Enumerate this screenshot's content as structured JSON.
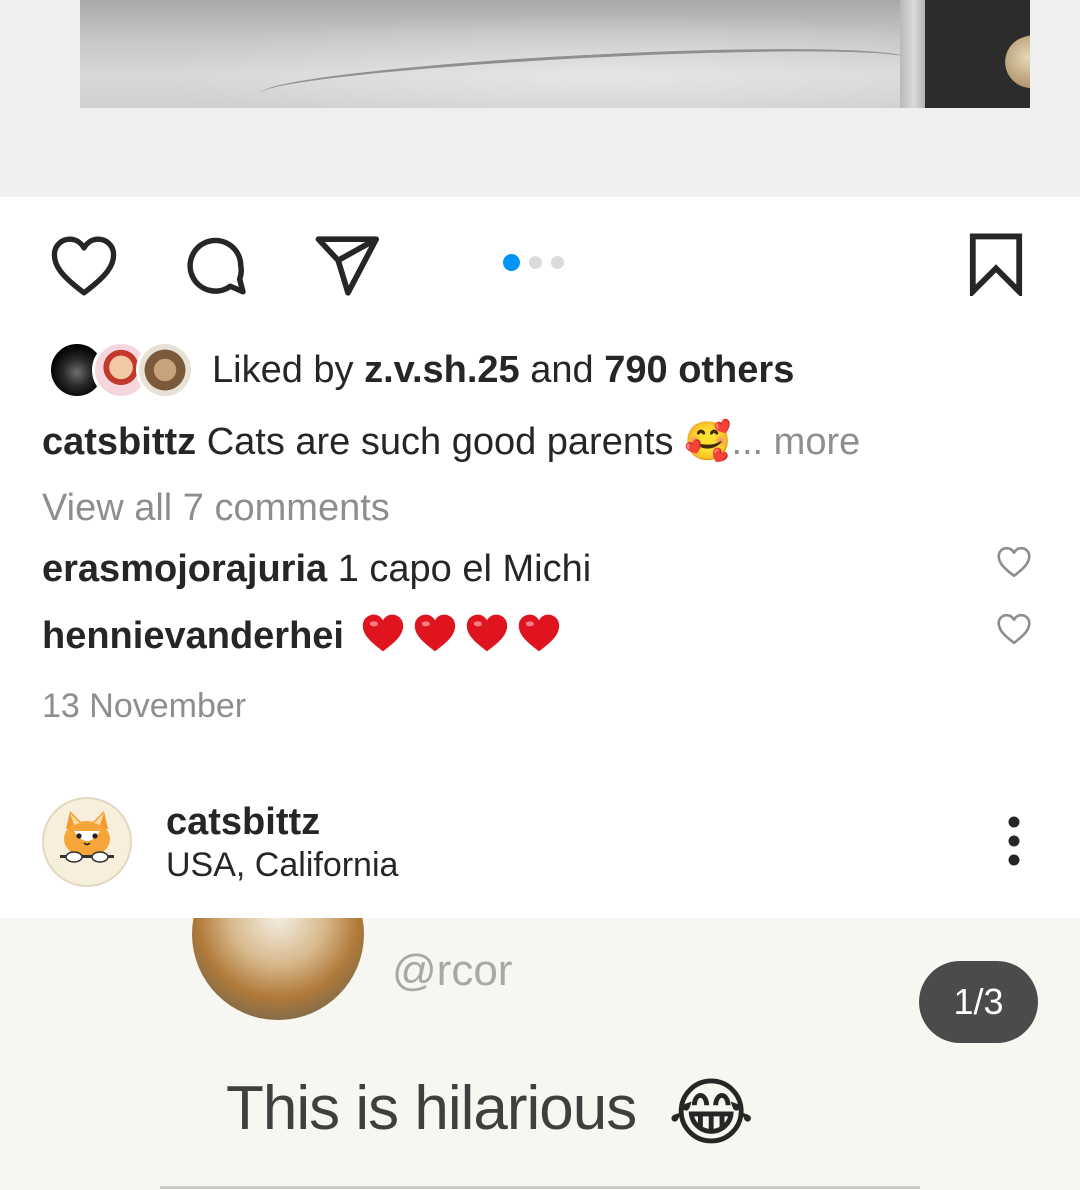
{
  "top_post": {
    "carousel": {
      "total": 3,
      "active_index": 0
    }
  },
  "likes": {
    "prefix": "Liked by ",
    "user": "z.v.sh.25",
    "connector": " and ",
    "others": "790 others"
  },
  "caption": {
    "username": "catsbittz",
    "text": "Cats are such good parents",
    "emoji": "🥰",
    "more": "... more"
  },
  "view_comments": "View all 7 comments",
  "comments": [
    {
      "username": "erasmojorajuria",
      "text": "1 capo el Michi"
    },
    {
      "username": "hennievanderhei",
      "hearts": 4
    }
  ],
  "date": "13 November",
  "next_post": {
    "username": "catsbittz",
    "location": "USA, California",
    "media": {
      "handle": "@rcor",
      "text": "This is hilarious",
      "emoji": "😂"
    },
    "counter": "1/3"
  },
  "colors": {
    "accent_blue": "#0095f6",
    "heart_red": "#e0141e",
    "muted_gray": "#8e8e8e",
    "text_dark": "#262626"
  },
  "icons": [
    "heart-icon",
    "comment-icon",
    "share-icon",
    "bookmark-icon",
    "more-vertical-icon",
    "small-heart-icon"
  ]
}
